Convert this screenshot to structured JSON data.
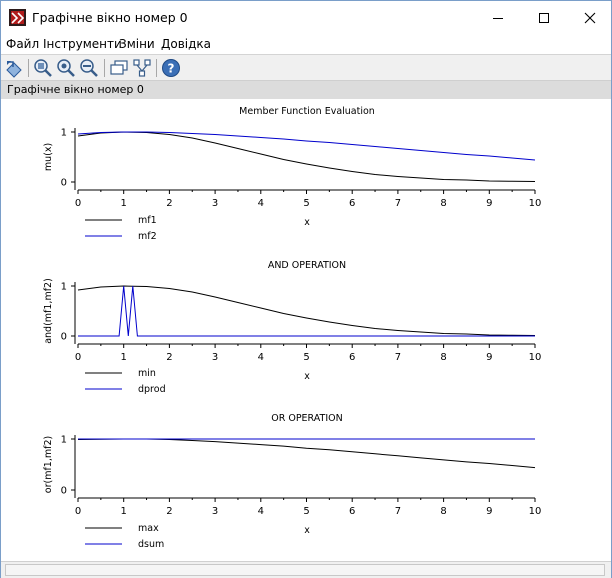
{
  "window": {
    "title": "Графічне вікно номер 0"
  },
  "menu": {
    "items": [
      "Файл",
      "Інструменти",
      "Зміни",
      "Довідка"
    ]
  },
  "toolbar": {
    "icons": [
      "rotate-icon",
      "zoom-in-icon",
      "zoom-fit-icon",
      "zoom-out-icon",
      "datatip-icon",
      "edit-axes-icon",
      "help-icon"
    ]
  },
  "infobar": {
    "text": "Графічне вікно номер 0"
  },
  "colors": {
    "series_primary": "#000000",
    "series_secondary": "#0000cc"
  },
  "chart_data": [
    {
      "type": "line",
      "title": "Member Function Evaluation",
      "xlabel": "x",
      "ylabel": "mu(x)",
      "xlim": [
        0,
        10
      ],
      "ylim": [
        0,
        1
      ],
      "xticks": [
        0,
        1,
        2,
        3,
        4,
        5,
        6,
        7,
        8,
        9,
        10
      ],
      "yticks": [
        0,
        1
      ],
      "x": [
        0,
        0.5,
        1,
        1.5,
        2,
        2.5,
        3,
        3.5,
        4,
        4.5,
        5,
        5.5,
        6,
        6.5,
        7,
        7.5,
        8,
        8.5,
        9,
        9.5,
        10
      ],
      "series": [
        {
          "name": "mf1",
          "color": "#000000",
          "values": [
            0.92,
            0.98,
            1.0,
            0.99,
            0.95,
            0.88,
            0.78,
            0.67,
            0.56,
            0.45,
            0.36,
            0.28,
            0.21,
            0.15,
            0.11,
            0.08,
            0.05,
            0.04,
            0.02,
            0.015,
            0.01
          ]
        },
        {
          "name": "mf2",
          "color": "#0000cc",
          "values": [
            0.96,
            0.99,
            1.0,
            1.0,
            0.99,
            0.97,
            0.95,
            0.92,
            0.89,
            0.86,
            0.82,
            0.79,
            0.75,
            0.71,
            0.67,
            0.63,
            0.59,
            0.55,
            0.52,
            0.48,
            0.44
          ]
        }
      ],
      "legend_position": "bottom-left"
    },
    {
      "type": "line",
      "title": "AND OPERATION",
      "xlabel": "x",
      "ylabel": "and(mf1,mf2)",
      "xlim": [
        0,
        10
      ],
      "ylim": [
        0,
        1
      ],
      "xticks": [
        0,
        1,
        2,
        3,
        4,
        5,
        6,
        7,
        8,
        9,
        10
      ],
      "yticks": [
        0,
        1
      ],
      "series": [
        {
          "name": "min",
          "color": "#000000",
          "x": [
            0,
            0.5,
            1,
            1.5,
            2,
            2.5,
            3,
            3.5,
            4,
            4.5,
            5,
            5.5,
            6,
            6.5,
            7,
            7.5,
            8,
            8.5,
            9,
            9.5,
            10
          ],
          "values": [
            0.92,
            0.98,
            1.0,
            0.99,
            0.95,
            0.88,
            0.78,
            0.67,
            0.56,
            0.45,
            0.36,
            0.28,
            0.21,
            0.15,
            0.11,
            0.08,
            0.05,
            0.04,
            0.02,
            0.015,
            0.01
          ]
        },
        {
          "name": "dprod",
          "color": "#0000cc",
          "x": [
            0,
            0.9,
            1.0,
            1.1,
            1.2,
            1.3,
            10
          ],
          "values": [
            0,
            0,
            1,
            0,
            1,
            0,
            0
          ]
        }
      ],
      "legend_position": "bottom-left"
    },
    {
      "type": "line",
      "title": "OR OPERATION",
      "xlabel": "x",
      "ylabel": "or(mf1,mf2)",
      "xlim": [
        0,
        10
      ],
      "ylim": [
        0,
        1
      ],
      "xticks": [
        0,
        1,
        2,
        3,
        4,
        5,
        6,
        7,
        8,
        9,
        10
      ],
      "yticks": [
        0,
        1
      ],
      "series": [
        {
          "name": "max",
          "color": "#000000",
          "x": [
            0,
            0.5,
            1,
            1.5,
            2,
            2.5,
            3,
            3.5,
            4,
            4.5,
            5,
            5.5,
            6,
            6.5,
            7,
            7.5,
            8,
            8.5,
            9,
            9.5,
            10
          ],
          "values": [
            0.99,
            0.995,
            1.0,
            1.0,
            0.99,
            0.97,
            0.95,
            0.92,
            0.89,
            0.86,
            0.82,
            0.79,
            0.75,
            0.71,
            0.67,
            0.63,
            0.59,
            0.55,
            0.52,
            0.48,
            0.44
          ]
        },
        {
          "name": "dsum",
          "color": "#0000cc",
          "x": [
            0,
            10
          ],
          "values": [
            1,
            1
          ]
        }
      ],
      "legend_position": "bottom-left"
    }
  ]
}
